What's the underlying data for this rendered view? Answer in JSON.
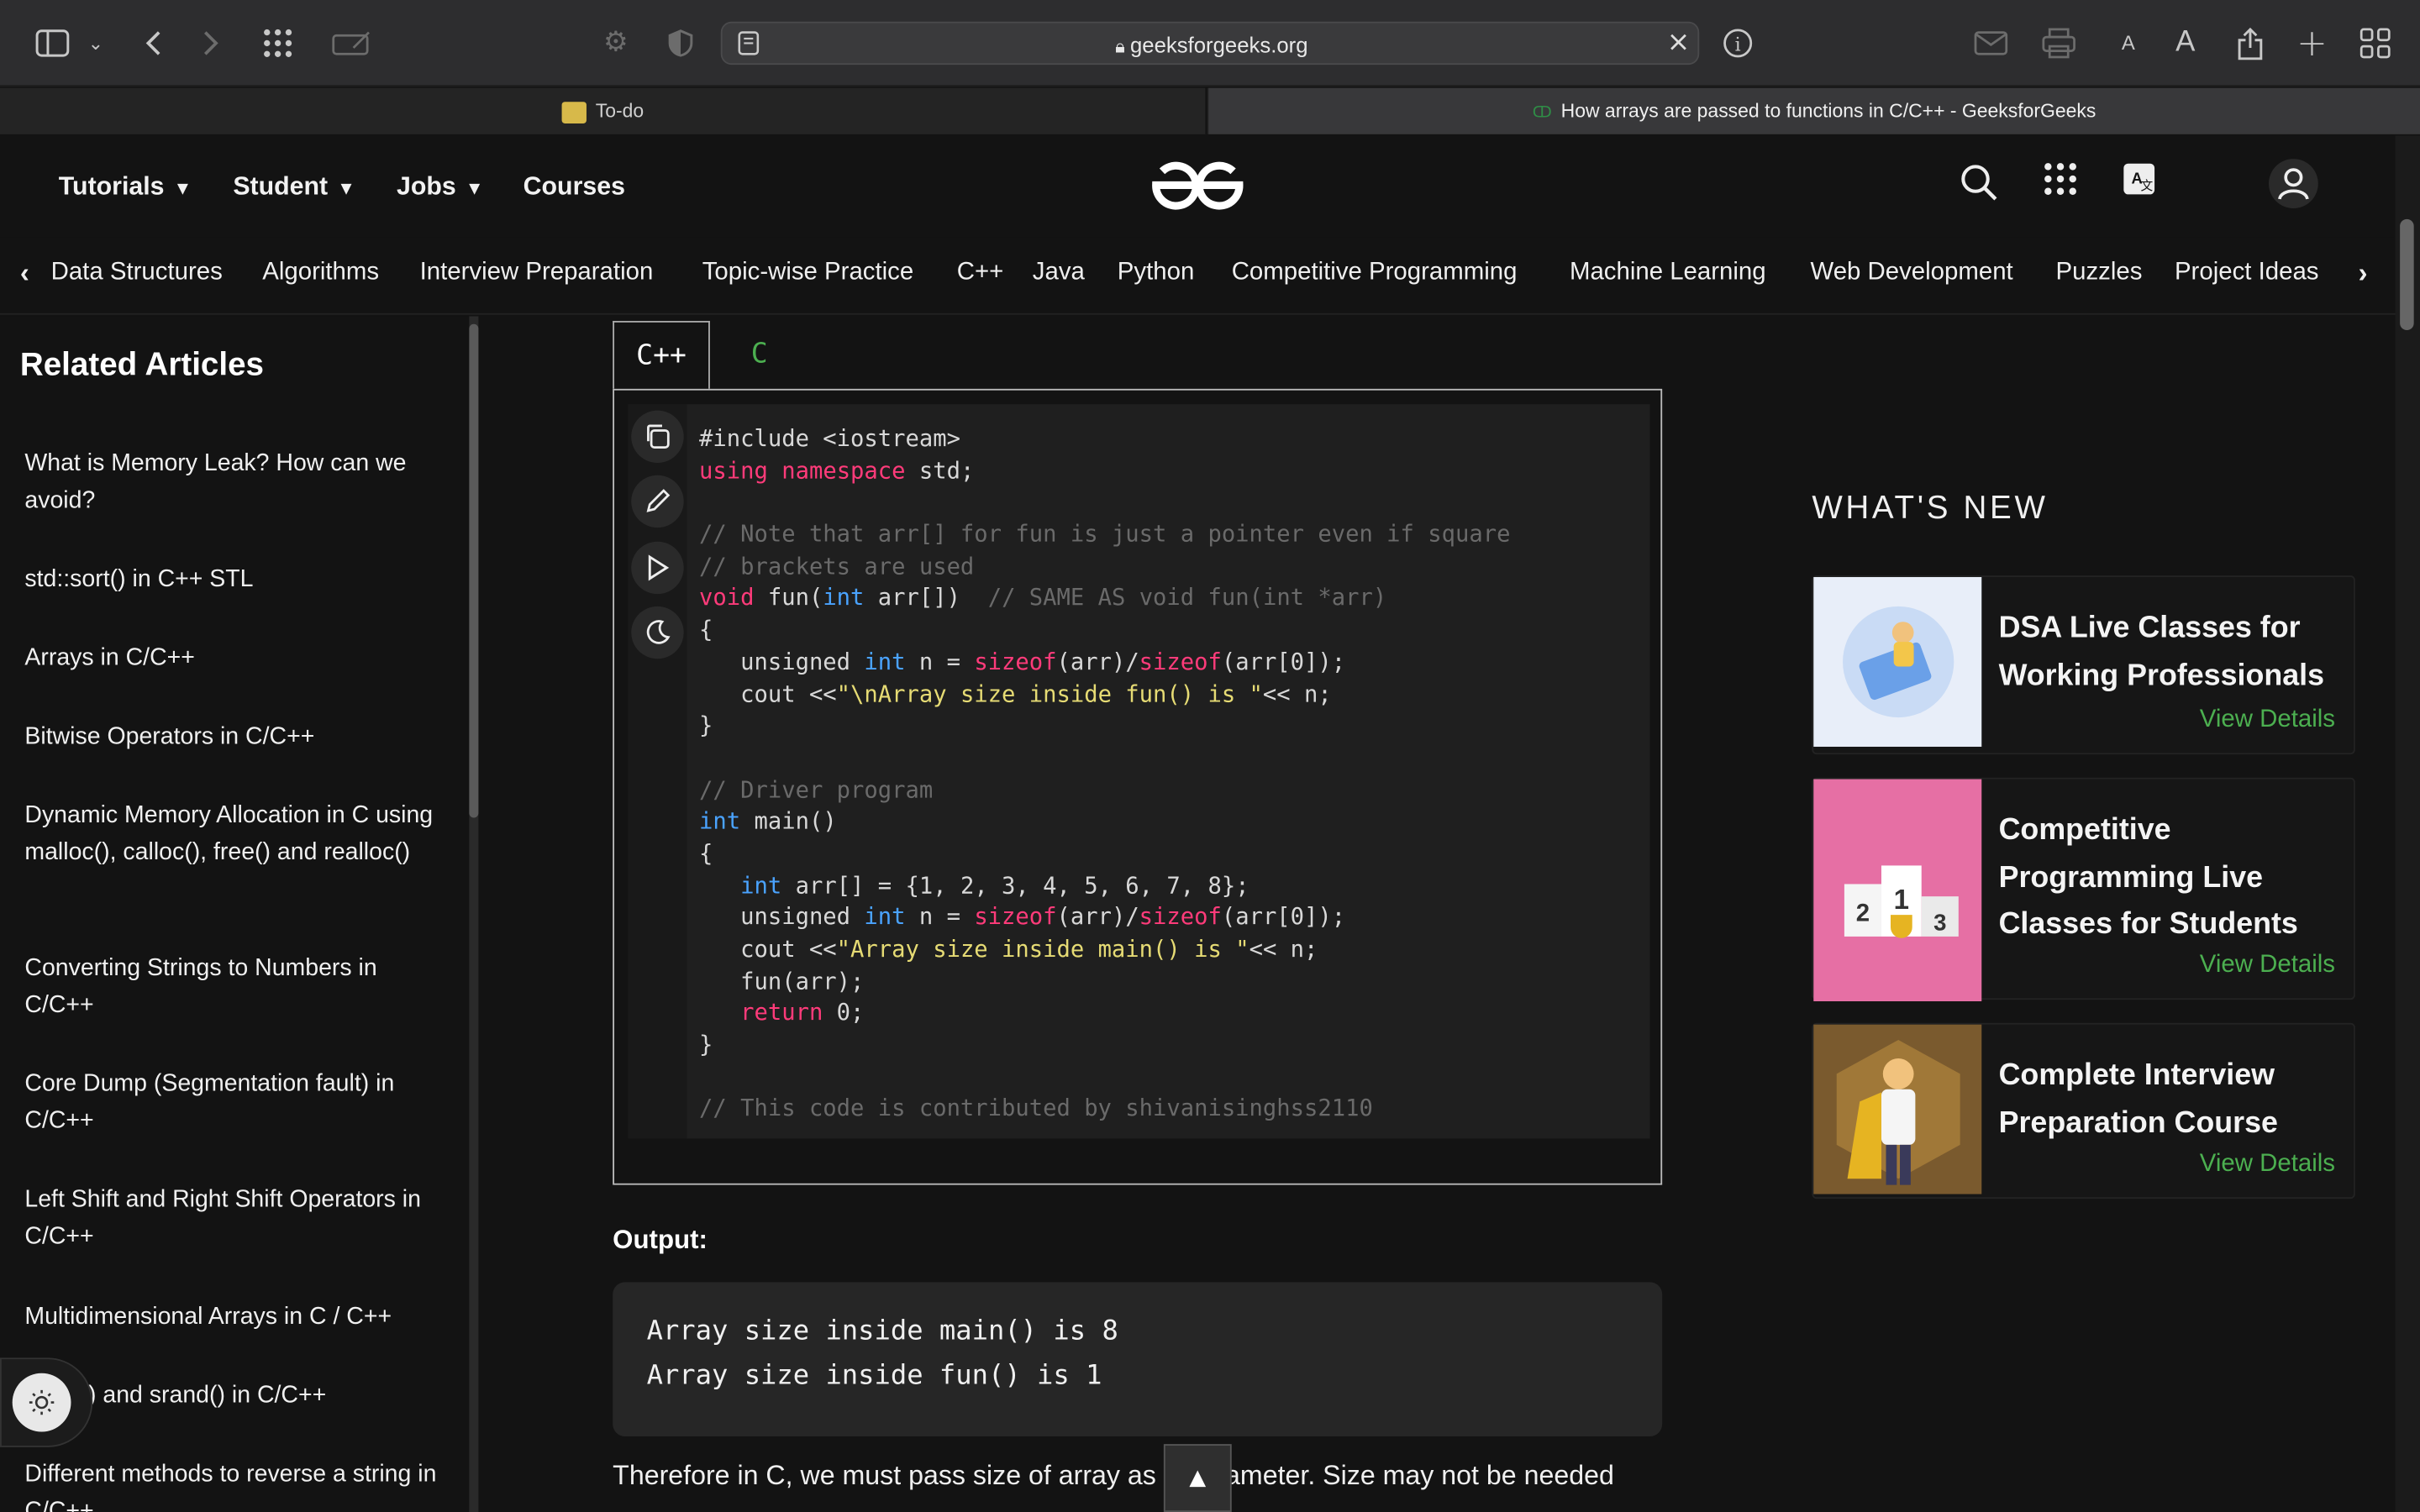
{
  "browser": {
    "url": "geeksforgeeks.org",
    "tabs": [
      {
        "title": "To-do",
        "active": false
      },
      {
        "title": "How arrays are passed to functions in C/C++ - GeeksforGeeks",
        "active": true
      }
    ]
  },
  "header": {
    "nav": [
      {
        "label": "Tutorials",
        "has_dropdown": true
      },
      {
        "label": "Student",
        "has_dropdown": true
      },
      {
        "label": "Jobs",
        "has_dropdown": true
      },
      {
        "label": "Courses",
        "has_dropdown": false
      }
    ],
    "icons": [
      "search-icon",
      "apps-grid-icon",
      "translate-icon",
      "user-icon"
    ]
  },
  "subnav": {
    "items": [
      "Data Structures",
      "Algorithms",
      "Interview Preparation",
      "Topic-wise Practice",
      "C++",
      "Java",
      "Python",
      "Competitive Programming",
      "Machine Learning",
      "Web Development",
      "Puzzles",
      "Project Ideas"
    ]
  },
  "sidebar": {
    "title": "Related Articles",
    "items": [
      "What is Memory Leak? How can we avoid?",
      "std::sort() in C++ STL",
      "Arrays in C/C++",
      "Bitwise Operators in C/C++",
      "Dynamic Memory Allocation in C using malloc(), calloc(), free() and realloc()",
      "Converting Strings to Numbers in C/C++",
      "Core Dump (Segmentation fault) in C/C++",
      "Left Shift and Right Shift Operators in C/C++",
      "Multidimensional Arrays in C / C++",
      "() and srand() in C/C++",
      "Different methods to reverse a string in C/C++"
    ]
  },
  "code_tabs": [
    "C++",
    "C"
  ],
  "code_lines": [
    "#include <iostream>",
    "using namespace std;",
    "",
    "// Note that arr[] for fun is just a pointer even if square",
    "// brackets are used",
    "void fun(int arr[])  // SAME AS void fun(int *arr)",
    "{",
    "   unsigned int n = sizeof(arr)/sizeof(arr[0]);",
    "   cout <<\"\\nArray size inside fun() is \"<< n;",
    "}",
    "",
    "// Driver program",
    "int main()",
    "{",
    "   int arr[] = {1, 2, 3, 4, 5, 6, 7, 8};",
    "   unsigned int n = sizeof(arr)/sizeof(arr[0]);",
    "   cout <<\"Array size inside main() is \"<< n;",
    "   fun(arr);",
    "   return 0;",
    "}",
    "",
    "// This code is contributed by shivanisinghss2110"
  ],
  "output": {
    "label": "Output:",
    "lines": [
      "Array size inside main() is 8",
      "Array size inside fun() is 1"
    ]
  },
  "body_text": "Therefore in C, we must pass size of array as a parameter. Size may not be needed",
  "whats_new": {
    "title": "WHAT'S NEW",
    "cards": [
      {
        "title": "DSA Live Classes for Working Professionals",
        "link": "View Details"
      },
      {
        "title": "Competitive Programming Live Classes for Students",
        "link": "View Details"
      },
      {
        "title": "Complete Interview Preparation Course",
        "link": "View Details"
      }
    ]
  },
  "colors": {
    "accent_green": "#4caf50",
    "keyword": "#ff3b7a",
    "type": "#4aa3ff",
    "string": "#e6db74",
    "comment": "#6a6a6a"
  }
}
